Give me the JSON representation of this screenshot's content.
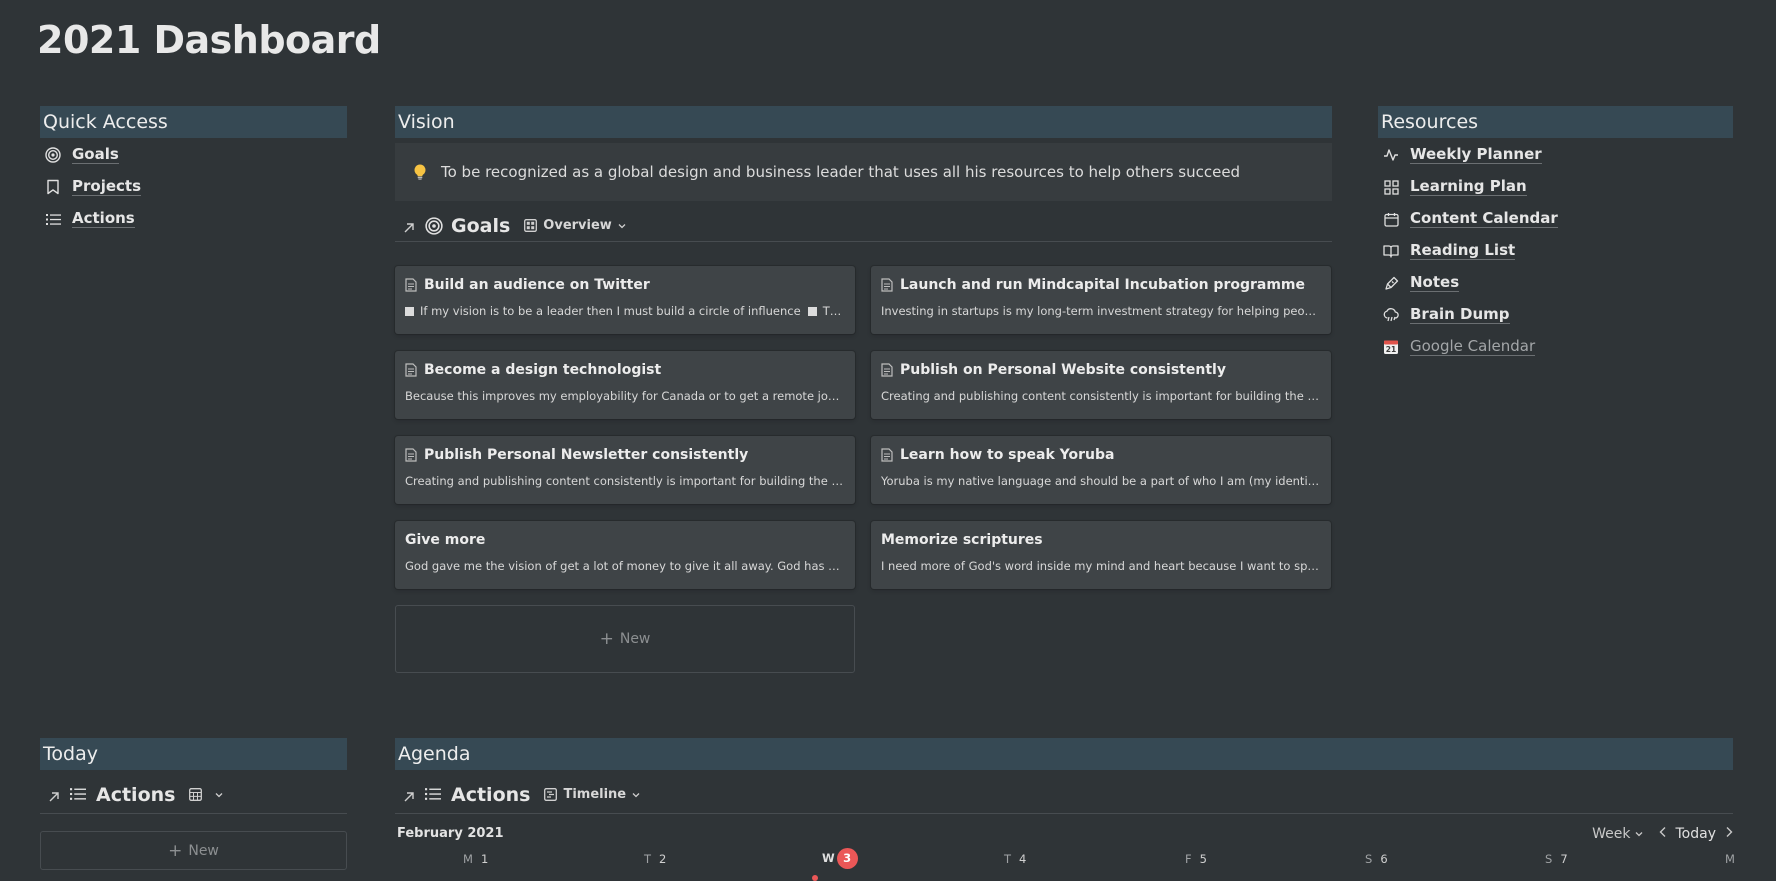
{
  "page": {
    "title": "2021 Dashboard"
  },
  "quick_access": {
    "heading": "Quick Access",
    "items": [
      {
        "label": "Goals",
        "icon": "target-icon"
      },
      {
        "label": "Projects",
        "icon": "bookmark-icon"
      },
      {
        "label": "Actions",
        "icon": "list-icon"
      }
    ]
  },
  "vision": {
    "heading": "Vision",
    "callout": "To be recognized as a global design and business leader that uses all his resources to help others succeed"
  },
  "goals_view": {
    "title": "Goals",
    "view_label": "Overview",
    "cards": [
      {
        "title": "Build an audience on Twitter",
        "body": "If my vision is to be a leader then I must build a circle of influence",
        "body_tail": "The mor...",
        "has_page_icon": true
      },
      {
        "title": "Launch and run Mindcapital Incubation programme",
        "body": "Investing in startups is my long-term investment strategy for helping people, crea...",
        "has_page_icon": true
      },
      {
        "title": "Become a design technologist",
        "body": "Because this improves my employability for Canada or to get a remote job that p...",
        "has_page_icon": true
      },
      {
        "title": "Publish on Personal Website consistently",
        "body": "Creating and publishing content consistently is important for building the audien...",
        "has_page_icon": true
      },
      {
        "title": "Publish Personal Newsletter consistently",
        "body": "Creating and publishing content consistently is important for building the audien...",
        "has_page_icon": true
      },
      {
        "title": "Learn how to speak Yoruba",
        "body": "Yoruba is my native language and should be a part of who I am (my identity). I wa...",
        "has_page_icon": true
      },
      {
        "title": "Give more",
        "body": "God gave me the vision of get a lot of money to give it all away. God has called m...",
        "has_page_icon": false
      },
      {
        "title": "Memorize scriptures",
        "body": "I need more of God's word inside my mind and heart because I want to speak mo...",
        "has_page_icon": false
      }
    ],
    "new_label": "New"
  },
  "resources": {
    "heading": "Resources",
    "items": [
      {
        "label": "Weekly Planner",
        "icon": "activity-icon"
      },
      {
        "label": "Learning Plan",
        "icon": "grid-icon"
      },
      {
        "label": "Content Calendar",
        "icon": "calendar-icon"
      },
      {
        "label": "Reading List",
        "icon": "book-icon"
      },
      {
        "label": "Notes",
        "icon": "pen-icon"
      },
      {
        "label": "Brain Dump",
        "icon": "cloud-rain-icon"
      },
      {
        "label": "Google Calendar",
        "icon": "calendar-21-icon"
      }
    ]
  },
  "today": {
    "heading": "Today",
    "view_title": "Actions",
    "new_label": "New"
  },
  "agenda": {
    "heading": "Agenda",
    "view_title": "Actions",
    "view_label": "Timeline",
    "month": "February 2021",
    "range": "Week",
    "today_button": "Today",
    "days": [
      {
        "letter": "M",
        "num": "1"
      },
      {
        "letter": "T",
        "num": "2"
      },
      {
        "letter": "W",
        "num": "3",
        "today": true
      },
      {
        "letter": "T",
        "num": "4"
      },
      {
        "letter": "F",
        "num": "5"
      },
      {
        "letter": "S",
        "num": "6"
      },
      {
        "letter": "S",
        "num": "7"
      },
      {
        "letter": "M",
        "num": ""
      }
    ]
  },
  "colors": {
    "background": "#2f3437",
    "section_header": "#364954",
    "card": "#3f4447",
    "today_marker": "#eb5757"
  }
}
